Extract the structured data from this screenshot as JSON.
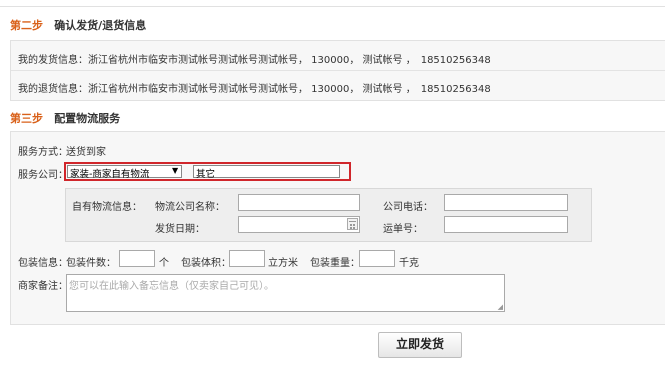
{
  "step2": {
    "label": "第二步",
    "title": "确认发货/退货信息",
    "ship_info": "我的发货信息：浙江省杭州市临安市测试帐号测试帐号测试帐号， 130000， 测试帐号 ，　18510256348",
    "return_info": "我的退货信息：浙江省杭州市临安市测试帐号测试帐号测试帐号， 130000， 测试帐号 ，　18510256348"
  },
  "step3": {
    "label": "第三步",
    "title": "配置物流服务",
    "service_mode_label": "服务方式：",
    "service_mode_value": "送货到家",
    "company_label": "服务公司：",
    "company_select": "家装-商家自有物流",
    "company_other": "其它",
    "own_logistics_label": "自有物流信息：",
    "company_name_label": "物流公司名称：",
    "company_phone_label": "公司电话：",
    "ship_date_label": "发货日期：",
    "tracking_label": "运单号：",
    "package_label": "包装信息：",
    "count_label": "包装件数：",
    "count_unit": "个",
    "volume_label": "包装体积：",
    "volume_unit": "立方米",
    "weight_label": "包装重量：",
    "weight_unit": "千克",
    "remark_label": "商家备注：",
    "remark_placeholder": "您可以在此输入备忘信息（仅卖家自己可见）。"
  },
  "submit_label": "立即发货",
  "colors": {
    "step_accent": "#d9611a",
    "highlight_border": "#d0262b"
  }
}
